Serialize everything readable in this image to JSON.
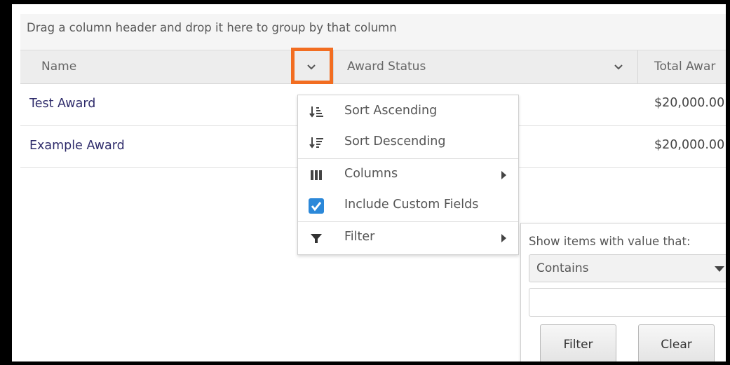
{
  "group_bar": {
    "text": "Drag a column header and drop it here to group by that column"
  },
  "columns": [
    {
      "label": "Name"
    },
    {
      "label": "Award Status"
    },
    {
      "label": "Total Awar"
    }
  ],
  "rows": [
    {
      "name": "Test Award",
      "total": "$20,000.00"
    },
    {
      "name": "Example Award",
      "total": "$20,000.00"
    }
  ],
  "menu": {
    "sort_asc": "Sort Ascending",
    "sort_desc": "Sort Descending",
    "columns": "Columns",
    "include_custom": "Include Custom Fields",
    "include_custom_checked": true,
    "filter": "Filter"
  },
  "filter_panel": {
    "title": "Show items with value that:",
    "operator": "Contains",
    "value": "",
    "filter_button": "Filter",
    "clear_button": "Clear"
  },
  "colors": {
    "highlight": "#f26d21",
    "link": "#2f2c6b",
    "checkbox": "#2b88d9"
  }
}
